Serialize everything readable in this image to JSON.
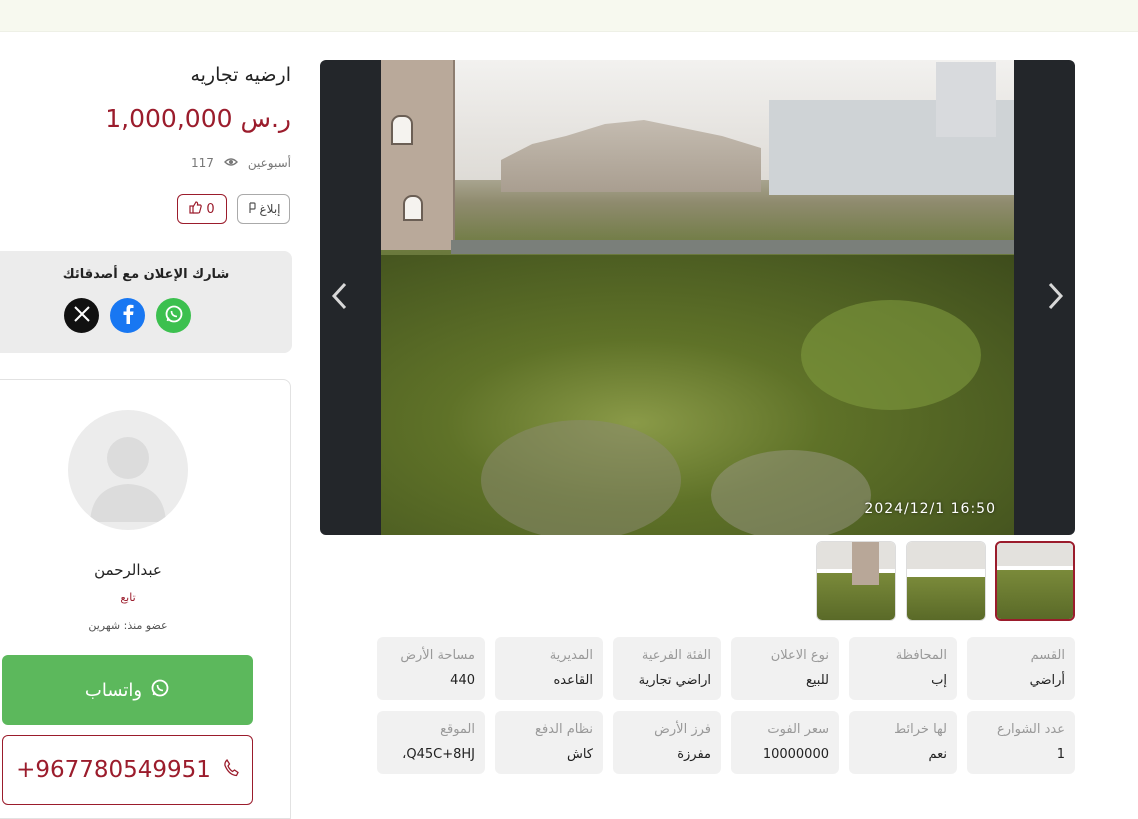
{
  "listing": {
    "title": "ارضيه تجاريه",
    "price": "1,000,000 ر.س",
    "age": "أسبوعين",
    "views": "117",
    "report_label": "إبلاغ",
    "likes": "0"
  },
  "share": {
    "title": "شارك الإعلان مع أصدقائك",
    "buttons": [
      "whatsapp-icon",
      "facebook-icon",
      "x-icon"
    ]
  },
  "seller": {
    "name": "عبدالرحمن",
    "role": "تابع",
    "member_since": "عضو منذ: شهرين",
    "whatsapp_label": "واتساب",
    "phone": "+967780549951"
  },
  "gallery": {
    "timestamp": "2024/12/1  16:50",
    "thumbnail_count": 3,
    "active_thumbnail": 1
  },
  "specs": [
    {
      "label": "القسم",
      "value": "أراضي"
    },
    {
      "label": "المحافظة",
      "value": "إب"
    },
    {
      "label": "نوع الاعلان",
      "value": "للبيع"
    },
    {
      "label": "الفئة الفرعية",
      "value": "اراضي تجارية"
    },
    {
      "label": "المديرية",
      "value": "القاعده"
    },
    {
      "label": "مساحة الأرض",
      "value": "440"
    },
    {
      "label": "عدد الشوارع",
      "value": "1"
    },
    {
      "label": "لها خرائط",
      "value": "نعم"
    },
    {
      "label": "سعر الفوت",
      "value": "10000000"
    },
    {
      "label": "فرز الأرض",
      "value": "مفرزة"
    },
    {
      "label": "نظام الدفع",
      "value": "كاش"
    },
    {
      "label": "الموقع",
      "value": "Q45C+8HJ،"
    }
  ],
  "colors": {
    "brand": "#9b1c2c",
    "whatsapp": "#5cb85c",
    "facebook": "#1877f2",
    "x": "#111111"
  }
}
